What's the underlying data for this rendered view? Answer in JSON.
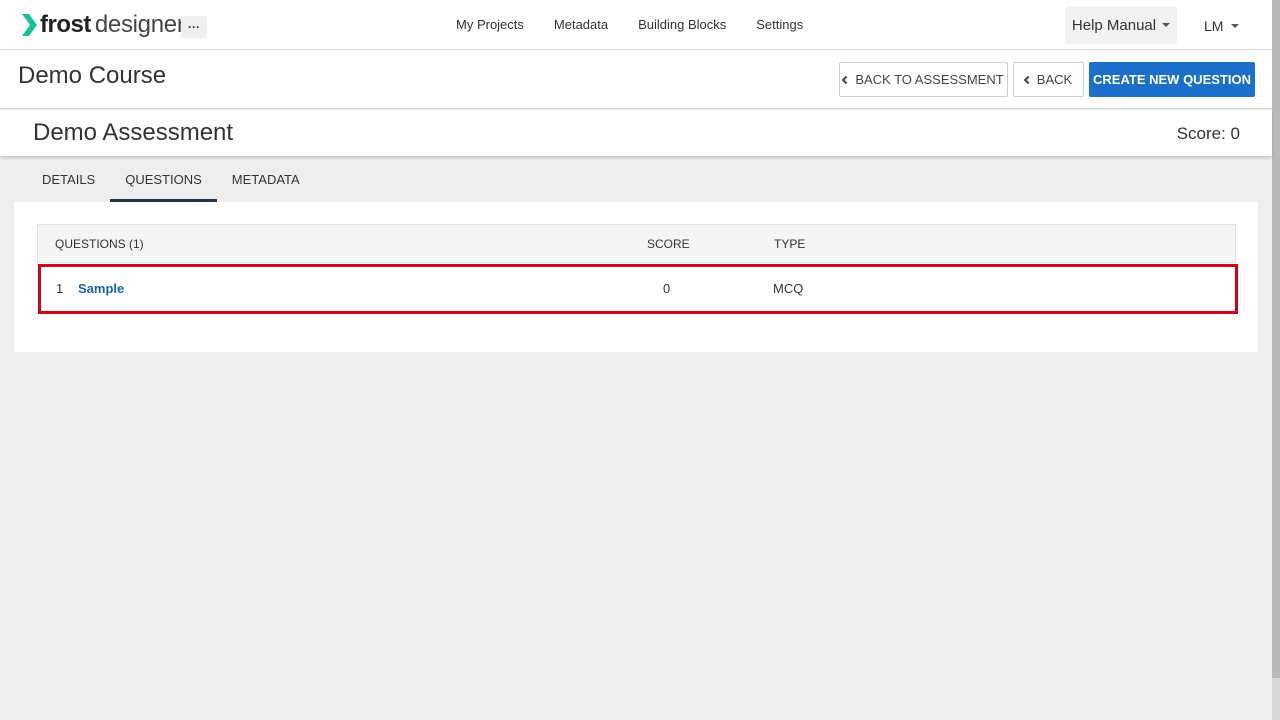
{
  "brand": {
    "word1": "frost",
    "word2": "designer",
    "accent": "#15c39a"
  },
  "topnav": {
    "more_label": "···",
    "links": [
      "My Projects",
      "Metadata",
      "Building Blocks",
      "Settings"
    ],
    "help_label": "Help Manual",
    "user_initials": "LM"
  },
  "course": {
    "title": "Demo Course",
    "back_to_assessment_label": "BACK TO ASSESSMENT",
    "back_label": "BACK",
    "create_label": "CREATE NEW QUESTION"
  },
  "assessment": {
    "title": "Demo Assessment",
    "score_label": "Score: 0"
  },
  "tabs": [
    {
      "label": "DETAILS",
      "active": false
    },
    {
      "label": "QUESTIONS",
      "active": true
    },
    {
      "label": "METADATA",
      "active": false
    }
  ],
  "questions_table": {
    "headers": {
      "questions": "QUESTIONS (1)",
      "score": "SCORE",
      "type": "TYPE"
    },
    "rows": [
      {
        "num": "1",
        "name": "Sample",
        "score": "0",
        "type": "MCQ"
      }
    ]
  },
  "colors": {
    "primary": "#1a6fc9",
    "highlight": "#d0021b",
    "link": "#1a62b0"
  }
}
